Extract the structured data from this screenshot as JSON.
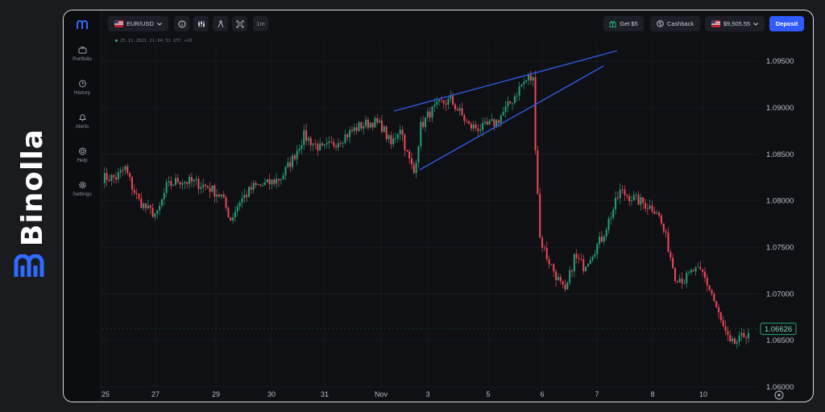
{
  "brand": {
    "name": "Binolla"
  },
  "sidebar": {
    "items": [
      {
        "label": "Portfolio",
        "icon": "briefcase-icon"
      },
      {
        "label": "History",
        "icon": "clock-history-icon"
      },
      {
        "label": "Alerts",
        "icon": "bell-icon"
      },
      {
        "label": "Help",
        "icon": "lifebuoy-icon"
      },
      {
        "label": "Settings",
        "icon": "gear-icon"
      }
    ]
  },
  "topbar": {
    "pair": "EUR/USD",
    "timeframe": "1m",
    "get_bonus": "Get $5",
    "cashback": "Cashback",
    "balance": "$9,505.55",
    "deposit": "Deposit"
  },
  "info_line": "25.11.2021 21:04:31 UTC +10",
  "colors": {
    "up": "#26a17b",
    "down": "#ef4957",
    "trendline": "#2f5bdf",
    "accent": "#2f5bff",
    "grid": "#1b1d23"
  },
  "chart_data": {
    "type": "candlestick",
    "y_ticks": [
      "1.09500",
      "1.09000",
      "1.08500",
      "1.08000",
      "1.07500",
      "1.07000",
      "1.06500",
      "1.06000"
    ],
    "ylim": [
      1.06,
      1.097
    ],
    "x_ticks": [
      "25",
      "27",
      "29",
      "30",
      "31",
      "Nov",
      "3",
      "5",
      "6",
      "7",
      "8",
      "10"
    ],
    "current_price": "1.06626",
    "close_path": [
      [
        0,
        1.0825
      ],
      [
        6,
        1.0825
      ],
      [
        10,
        1.0835
      ],
      [
        13,
        1.0815
      ],
      [
        16,
        1.08
      ],
      [
        20,
        1.079
      ],
      [
        24,
        1.0785
      ],
      [
        28,
        1.0815
      ],
      [
        33,
        1.0822
      ],
      [
        40,
        1.082
      ],
      [
        46,
        1.0815
      ],
      [
        52,
        1.0805
      ],
      [
        56,
        1.078
      ],
      [
        60,
        1.08
      ],
      [
        66,
        1.0815
      ],
      [
        72,
        1.0818
      ],
      [
        78,
        1.0825
      ],
      [
        83,
        1.0845
      ],
      [
        88,
        1.087
      ],
      [
        92,
        1.0862
      ],
      [
        96,
        1.0855
      ],
      [
        100,
        1.086
      ],
      [
        106,
        1.087
      ],
      [
        112,
        1.088
      ],
      [
        118,
        1.0885
      ],
      [
        122,
        1.088
      ],
      [
        126,
        1.086
      ],
      [
        130,
        1.088
      ],
      [
        133,
        1.085
      ],
      [
        136,
        1.083
      ],
      [
        139,
        1.088
      ],
      [
        143,
        1.0895
      ],
      [
        148,
        1.0905
      ],
      [
        152,
        1.0908
      ],
      [
        156,
        1.0895
      ],
      [
        160,
        1.088
      ],
      [
        166,
        1.0878
      ],
      [
        172,
        1.0885
      ],
      [
        178,
        1.0905
      ],
      [
        183,
        1.0925
      ],
      [
        186,
        1.0932
      ],
      [
        188,
        1.093
      ],
      [
        189,
        1.086
      ],
      [
        191,
        1.076
      ],
      [
        194,
        1.074
      ],
      [
        198,
        1.072
      ],
      [
        202,
        1.07
      ],
      [
        206,
        1.074
      ],
      [
        210,
        1.073
      ],
      [
        214,
        1.0745
      ],
      [
        218,
        1.076
      ],
      [
        222,
        1.0785
      ],
      [
        226,
        1.081
      ],
      [
        230,
        1.0805
      ],
      [
        234,
        1.08
      ],
      [
        238,
        1.0795
      ],
      [
        242,
        1.079
      ],
      [
        246,
        1.076
      ],
      [
        250,
        1.072
      ],
      [
        254,
        1.0715
      ],
      [
        258,
        1.0725
      ],
      [
        262,
        1.0722
      ],
      [
        266,
        1.07
      ],
      [
        270,
        1.067
      ],
      [
        274,
        1.0645
      ],
      [
        278,
        1.065
      ],
      [
        282,
        1.066
      ]
    ]
  }
}
